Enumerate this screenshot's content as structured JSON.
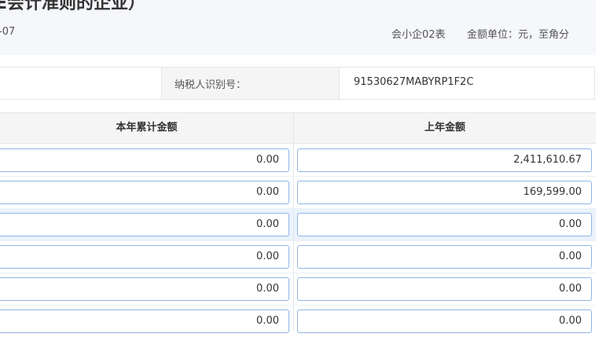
{
  "header": {
    "title": "E会计准则的企业）",
    "period": "-07",
    "form_code": "会小企02表",
    "unit": "金额单位：元，至角分"
  },
  "taxpayer": {
    "label": "纳税人识别号：",
    "value": "91530627MABYRP1F2C"
  },
  "table": {
    "columns": [
      "本年累计金额",
      "上年金额"
    ],
    "rows": [
      {
        "current": "0.00",
        "previous": "2,411,610.67"
      },
      {
        "current": "0.00",
        "previous": "169,599.00"
      },
      {
        "current": "0.00",
        "previous": "0.00",
        "highlighted": true
      },
      {
        "current": "0.00",
        "previous": "0.00"
      },
      {
        "current": "0.00",
        "previous": "0.00"
      },
      {
        "current": "0.00",
        "previous": "0.00"
      }
    ]
  }
}
